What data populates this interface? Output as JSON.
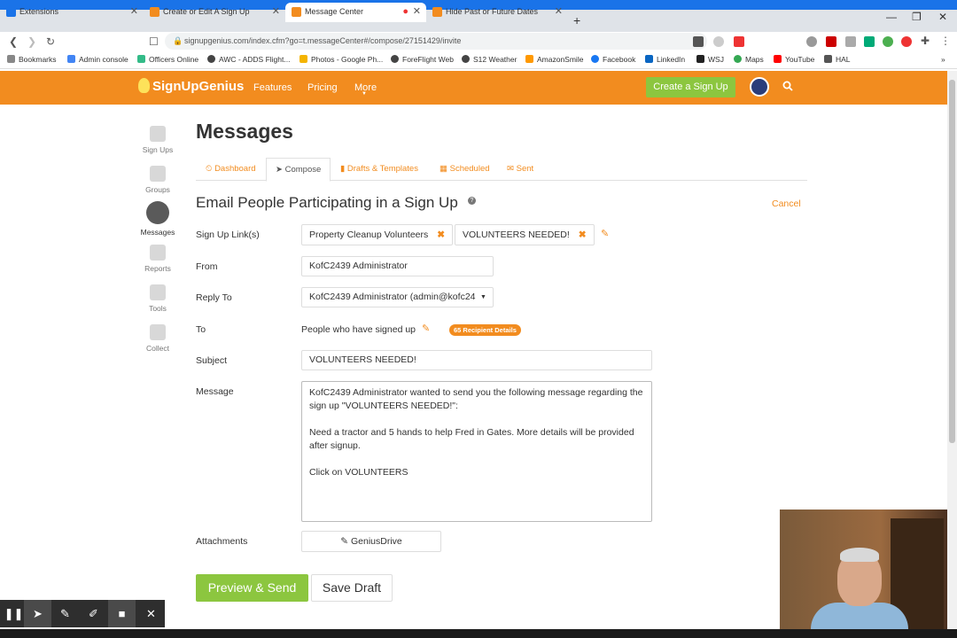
{
  "browser": {
    "tabs": [
      {
        "label": "Extensions",
        "color": "#1a73e8"
      },
      {
        "label": "Create or Edit A Sign Up",
        "color": "#f28c1f"
      },
      {
        "label": "Message Center",
        "color": "#f28c1f"
      },
      {
        "label": "Hide Past or Future Dates",
        "color": "#f28c1f"
      }
    ],
    "new_tab": "+",
    "url": "signupgenius.com/index.cfm?go=t.messageCenter#/compose/27151429/invite",
    "bookmarks": [
      "Bookmarks",
      "Admin console",
      "Officers Online",
      "AWC - ADDS Flight...",
      "Photos - Google Ph...",
      "ForeFlight Web",
      "S12 Weather",
      "AmazonSmile",
      "Facebook",
      "LinkedIn",
      "WSJ",
      "Maps",
      "YouTube",
      "HAL"
    ]
  },
  "site": {
    "logo": "SignUpGenius",
    "nav": [
      "Features",
      "Pricing",
      "More"
    ],
    "create_btn": "Create a Sign Up"
  },
  "sidebar": [
    "Sign Ups",
    "Groups",
    "Messages",
    "Reports",
    "Tools",
    "Collect"
  ],
  "page": {
    "title": "Messages",
    "tabs": [
      "Dashboard",
      "Compose",
      "Drafts & Templates",
      "Scheduled",
      "Sent"
    ],
    "section_title": "Email People Participating in a Sign Up",
    "cancel": "Cancel"
  },
  "form": {
    "signup_label": "Sign Up Link(s)",
    "signup_chips": [
      "Property Cleanup Volunteers",
      "VOLUNTEERS NEEDED!"
    ],
    "from_label": "From",
    "from_value": "KofC2439 Administrator",
    "reply_label": "Reply To",
    "reply_value": "KofC2439 Administrator (admin@kofc24",
    "to_label": "To",
    "to_value": "People who have signed up",
    "recipient_badge": "65 Recipient Details",
    "subject_label": "Subject",
    "subject_value": "VOLUNTEERS NEEDED!",
    "message_label": "Message",
    "message_p1": "KofC2439 Administrator wanted to send you the following message regarding the sign up \"VOLUNTEERS NEEDED!\":",
    "message_p2": "Need a tractor and 5 hands to help Fred in Gates.  More details will be provided after signup.",
    "message_p3": "Click on VOLUNTEERS",
    "attachments_label": "Attachments",
    "attach_btn": "GeniusDrive",
    "preview_btn": "Preview & Send",
    "draft_btn": "Save Draft"
  }
}
